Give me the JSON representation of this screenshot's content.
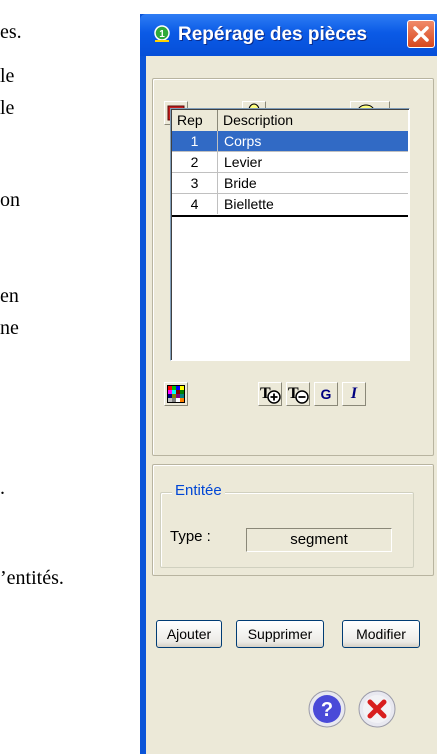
{
  "background_text": [
    "es.",
    "le",
    "le",
    "on",
    "en",
    "ne",
    ".",
    "’entités."
  ],
  "window": {
    "title": "Repérage des pièces",
    "close_button": "close-icon"
  },
  "toolbar": {
    "icons": [
      "insert-parts-icon",
      "bulb-icon",
      "zoom-icon",
      "dropdown-arrow-icon"
    ]
  },
  "table": {
    "columns": [
      "Rep",
      "Description"
    ],
    "rows": [
      {
        "rep": "1",
        "description": "Corps",
        "selected": true
      },
      {
        "rep": "2",
        "description": "Levier",
        "selected": false
      },
      {
        "rep": "3",
        "description": "Bride",
        "selected": false
      },
      {
        "rep": "4",
        "description": "Biellette",
        "selected": false
      }
    ]
  },
  "format_toolbar": {
    "icons": [
      "color-palette-icon",
      "text-size-plus-icon",
      "text-size-minus-icon",
      "bold-icon",
      "italic-icon"
    ],
    "bold_glyph": "G",
    "italic_glyph": "I"
  },
  "entity": {
    "group_label": "Entitée",
    "type_label": "Type :",
    "type_value": "segment"
  },
  "actions": {
    "add": "Ajouter",
    "delete": "Supprimer",
    "modify": "Modifier"
  },
  "footer": {
    "help_icon": "help-icon",
    "cancel_icon": "cancel-icon"
  },
  "colors": {
    "titlebar": "#0a5ae6",
    "selection": "#316ac5",
    "face": "#ece9d8",
    "group_label": "#0046d5"
  }
}
